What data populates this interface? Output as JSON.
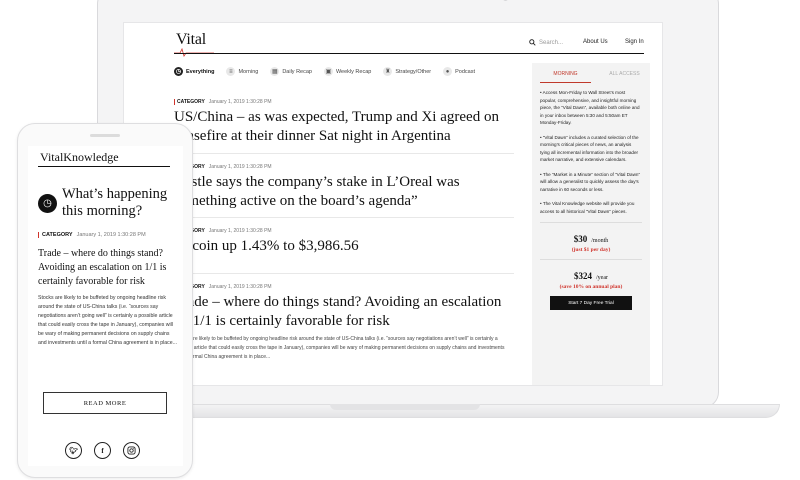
{
  "desktop": {
    "logo": "Vital",
    "search_placeholder": "Search...",
    "about_link": "About Us",
    "signin_link": "Sign In",
    "filters": [
      {
        "label": "Everything",
        "icon": "clock-icon"
      },
      {
        "label": "Morning",
        "icon": "news-icon"
      },
      {
        "label": "Daily Recap",
        "icon": "calendar-icon"
      },
      {
        "label": "Weekly Recap",
        "icon": "week-icon"
      },
      {
        "label": "Strategy/Other",
        "icon": "trophy-icon"
      },
      {
        "label": "Podcast",
        "icon": "mic-icon"
      }
    ],
    "feed": [
      {
        "category": "CATEGORY",
        "date": "January 1, 2019 1:30:28 PM",
        "headline": "US/China – as was expected, Trump and Xi agreed on ceasefire at their dinner Sat night in Argentina",
        "snippet": ""
      },
      {
        "category": "CATEGORY",
        "date": "January 1, 2019 1:30:28 PM",
        "headline": "Nestle says the company’s stake in L’Oreal was something active on the board’s agenda”",
        "snippet": ""
      },
      {
        "category": "CATEGORY",
        "date": "January 1, 2019 1:30:28 PM",
        "headline": "Bitcoin up 1.43% to $3,986.56",
        "snippet": ""
      },
      {
        "category": "CATEGORY",
        "date": "January 1, 2019 1:30:28 PM",
        "headline": "Trade – where do things stand? Avoiding an escalation on 1/1 is certainly favorable for risk",
        "snippet": "Stocks are likely to be buffeted by ongoing headline risk around the state of US-China talks (i.e. “sources say negotiations aren’t well” is certainly a possible article that could easily cross the tape in January), companies will be wary of making permanent decisions on supply chains and investments until a formal China agreement is in place..."
      }
    ],
    "sidebar": {
      "tabs": [
        "MORNING",
        "ALL ACCESS"
      ],
      "bullets": [
        "Access Mon-Friday to Wall Street’s most popular, comprehensive, and insightful morning piece, the “Vital Dawn”, available both online and in your inbox between 5:30 and 5:50am ET Monday-Friday.",
        "“Vital Dawn” includes a curated selection of the morning’s critical pieces of news, an analysis tying all incremental information into the broader market narrative, and extensive calendars.",
        "The “Market in a Minute” section of “Vital Dawn” will allow a generalist to quickly assess the day’s narrative in 60 seconds or less.",
        "The Vital Knowledge website will provide you access to all historical “Vital Dawn” pieces."
      ],
      "price_month": "$30",
      "price_month_unit": "/month",
      "price_month_note": "(just $1 per day)",
      "price_year": "$324",
      "price_year_unit": "/year",
      "price_year_note": "(save 10% on annual plan)",
      "trial_button": "Start 7 Day Free Trial"
    }
  },
  "mobile": {
    "logo": "VitalKnowledge",
    "title": "What’s happening this morning?",
    "category": "CATEGORY",
    "date": "January 1, 2019 1:30:28 PM",
    "headline": "Trade – where do things stand? Avoiding an escalation on 1/1 is certainly favorable for risk",
    "snippet": "Stocks are likely to be buffeted by ongoing headline risk around the state of US-China talks (i.e. “sources say negotiations aren’t going well” is certainly a possible article that could easily cross the tape in January), companies will be wary of making permanent decisions on supply chains and investments until a formal China agreement is in place...",
    "read_more": "READ MORE",
    "social": [
      "twitter-icon",
      "facebook-icon",
      "instagram-icon"
    ]
  },
  "colors": {
    "accent": "#d0342c",
    "text": "#111111",
    "sidebar_bg": "#f3f3f3"
  }
}
